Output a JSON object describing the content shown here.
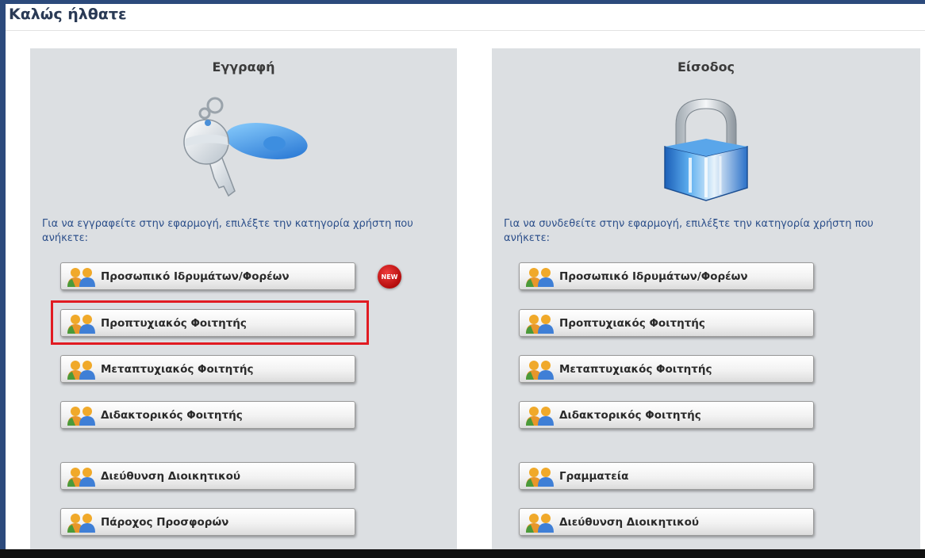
{
  "header": {
    "title": "Καλώς ήλθατε"
  },
  "registration": {
    "title": "Εγγραφή",
    "icon": "key-icon",
    "instructions": "Για να εγγραφείτε στην εφαρμογή, επιλέξτε την κατηγορία χρήστη που ανήκετε:",
    "new_badge": "NEW",
    "buttons": [
      {
        "label": "Προσωπικό Ιδρυμάτων/Φορέων",
        "icon": "users-icon"
      },
      {
        "label": "Προπτυχιακός Φοιτητής",
        "icon": "users-icon",
        "highlighted": true
      },
      {
        "label": "Μεταπτυχιακός Φοιτητής",
        "icon": "users-icon"
      },
      {
        "label": "Διδακτορικός Φοιτητής",
        "icon": "users-icon"
      },
      {
        "label": "Διεύθυνση Διοικητικού",
        "icon": "users-icon"
      },
      {
        "label": "Πάροχος Προσφορών",
        "icon": "users-icon"
      }
    ]
  },
  "login": {
    "title": "Είσοδος",
    "icon": "padlock-icon",
    "instructions": "Για να συνδεθείτε στην εφαρμογή, επιλέξτε την κατηγορία χρήστη που ανήκετε:",
    "buttons": [
      {
        "label": "Προσωπικό Ιδρυμάτων/Φορέων",
        "icon": "users-icon"
      },
      {
        "label": "Προπτυχιακός Φοιτητής",
        "icon": "users-icon"
      },
      {
        "label": "Μεταπτυχιακός Φοιτητής",
        "icon": "users-icon"
      },
      {
        "label": "Διδακτορικός Φοιτητής",
        "icon": "users-icon"
      },
      {
        "label": "Γραμματεία",
        "icon": "users-icon"
      },
      {
        "label": "Διεύθυνση Διοικητικού",
        "icon": "users-icon"
      }
    ]
  },
  "colors": {
    "highlight": "#e11b22",
    "panel_bg": "#dcdfe2",
    "frame": "#2c4a7c",
    "link_text": "#2c4f8a"
  }
}
